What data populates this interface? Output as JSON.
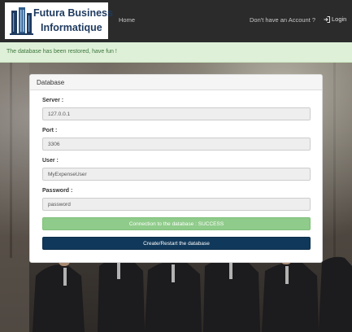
{
  "navbar": {
    "logo": {
      "line1": "Futura Business",
      "line2": "Informatique"
    },
    "home_label": "Home",
    "signup_label": "Don't have an Account ?",
    "login_label": "Login",
    "login_icon": "sign-in-icon"
  },
  "alert": {
    "text": "The database has been restored, have fun !",
    "color": "#3c763d",
    "background": "#dff0d8"
  },
  "panel": {
    "title": "Database",
    "fields": [
      {
        "label": "Server :",
        "value": "127.0.0.1"
      },
      {
        "label": "Port :",
        "value": "3306"
      },
      {
        "label": "User :",
        "value": "MyExpenseUser"
      },
      {
        "label": "Password :",
        "value": "password"
      }
    ],
    "status_button": {
      "label": "Connection to the database : SUCCESS",
      "color": "#8fcb8a"
    },
    "create_button": {
      "label": "Create/Restart the database",
      "color": "#10385a"
    }
  }
}
